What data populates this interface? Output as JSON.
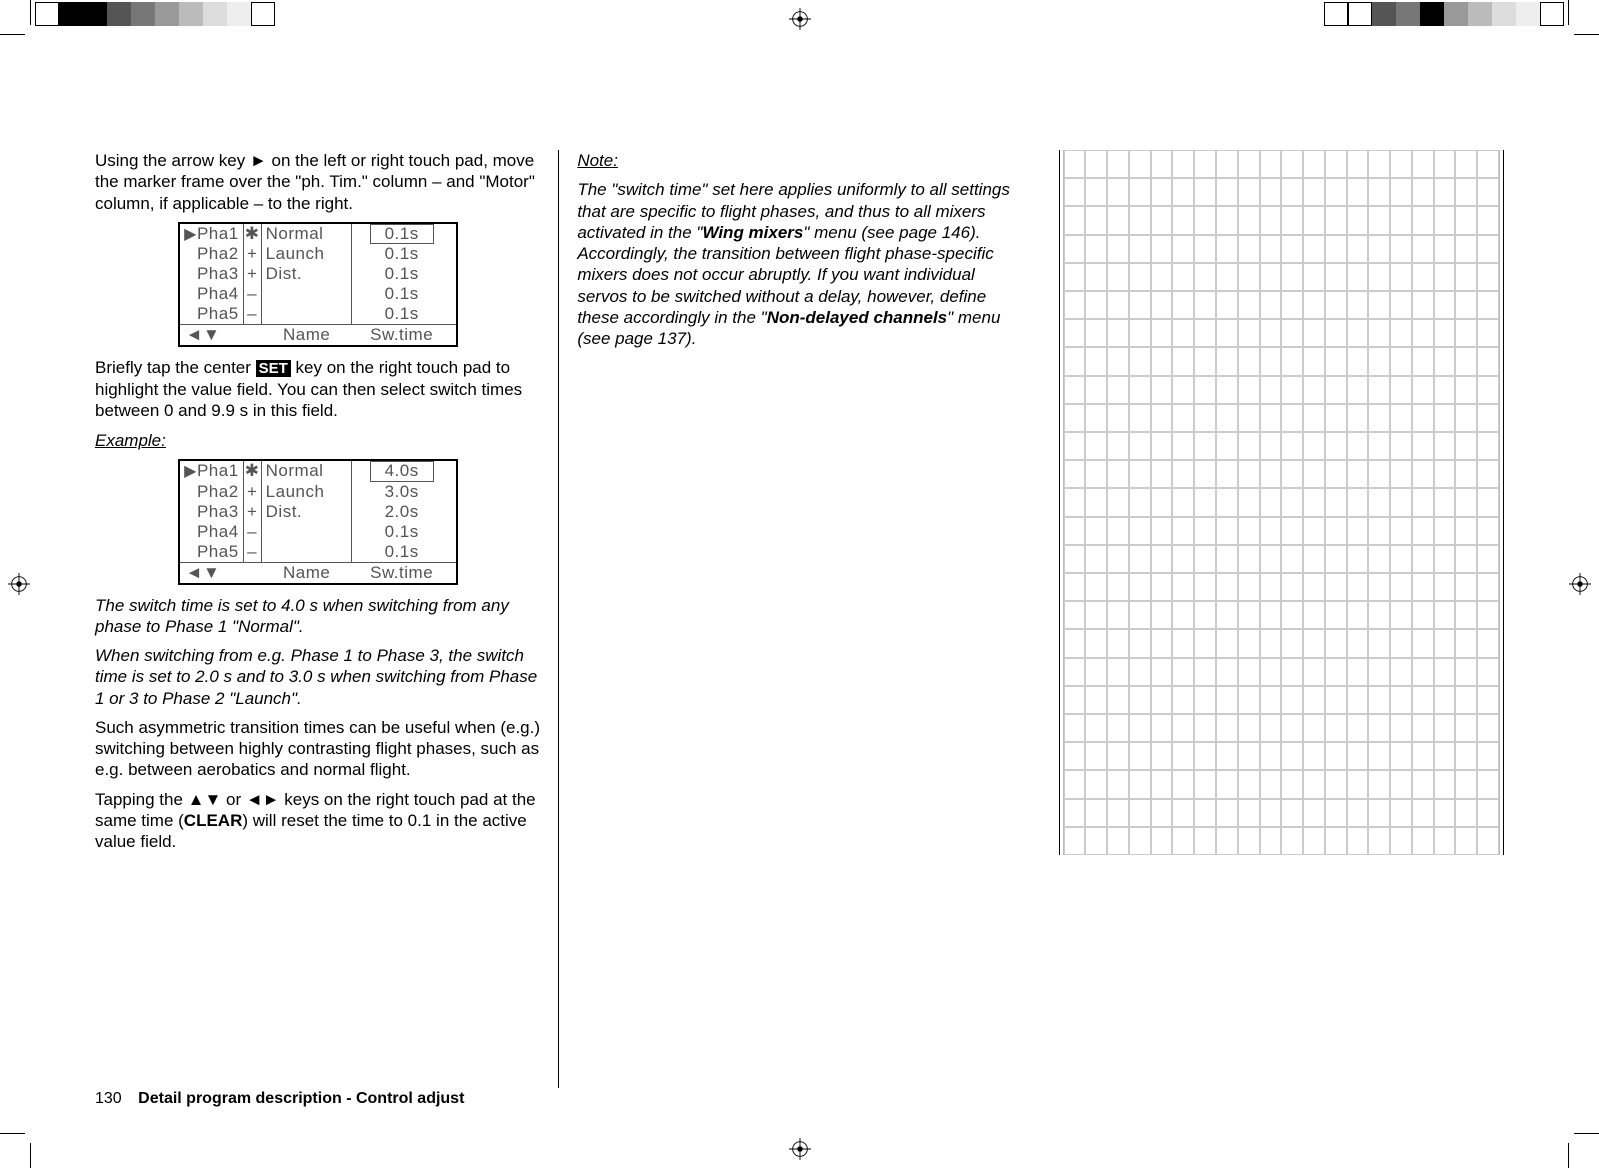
{
  "col1": {
    "para1_a": "Using the arrow key ",
    "para1_b": " on the left or right touch pad, move the marker frame over the \"ph. Tim.\" column – and \"Motor\" column, if applicable – to the right.",
    "lcd1": {
      "rows": [
        {
          "pha": "Pha1",
          "sym": "✱",
          "name": "Normal",
          "time": "0.1s",
          "hl": true,
          "tri": true
        },
        {
          "pha": "Pha2",
          "sym": "+",
          "name": "Launch",
          "time": "0.1s"
        },
        {
          "pha": "Pha3",
          "sym": "+",
          "name": "Dist.",
          "time": "0.1s"
        },
        {
          "pha": "Pha4",
          "sym": "–",
          "name": "",
          "time": "0.1s"
        },
        {
          "pha": "Pha5",
          "sym": "–",
          "name": "",
          "time": "0.1s"
        }
      ],
      "footer_arrows": "◄▼",
      "footer_name": "Name",
      "footer_sw": "Sw.time"
    },
    "para2_a": "Briefly tap the center ",
    "para2_set": "SET",
    "para2_b": " key on the right touch pad to highlight the value field. You can then select switch times between 0 and 9.9 s in this field.",
    "example_label": "Example:",
    "lcd2": {
      "rows": [
        {
          "pha": "Pha1",
          "sym": "✱",
          "name": "Normal",
          "time": "4.0s",
          "hl": true,
          "tri": true
        },
        {
          "pha": "Pha2",
          "sym": "+",
          "name": "Launch",
          "time": "3.0s"
        },
        {
          "pha": "Pha3",
          "sym": "+",
          "name": "Dist.",
          "time": "2.0s"
        },
        {
          "pha": "Pha4",
          "sym": "–",
          "name": "",
          "time": "0.1s"
        },
        {
          "pha": "Pha5",
          "sym": "–",
          "name": "",
          "time": "0.1s"
        }
      ],
      "footer_arrows": "◄▼",
      "footer_name": "Name",
      "footer_sw": "Sw.time"
    },
    "para3": "The switch time is set to 4.0 s when switching from any phase to Phase 1 \"Normal\".",
    "para4": "When switching from e.g. Phase 1 to Phase 3, the switch time is set to 2.0 s and to 3.0 s when switching from Phase 1 or 3 to Phase 2 \"Launch\".",
    "para5": "Such asymmetric transition times can be useful when (e.g.) switching between highly contrasting flight phases, such as e.g. between aerobatics and normal flight.",
    "para6_a": "Tapping the ",
    "para6_arrows1": "▲▼",
    "para6_b": " or ",
    "para6_arrows2": "◄►",
    "para6_c": " keys on the right touch pad at the same time (",
    "para6_clear": "CLEAR",
    "para6_d": ") will reset the time to 0.1 in the active value field."
  },
  "col2": {
    "note_label": "Note:",
    "note_a": "The \"switch time\" set here applies uniformly to all settings that are specific to flight phases, and thus to all mixers activated in the \"",
    "note_wing": "Wing mixers",
    "note_b": "\" menu (see page 146). Accordingly, the transition between flight phase-specific mixers does not occur abruptly. If you want individual servos to be switched without a delay, however, define these accordingly in the \"",
    "note_nd": "Non-delayed channels",
    "note_c": "\" menu (see page 137)."
  },
  "footer": {
    "page": "130",
    "section": "Detail program description - Control adjust"
  },
  "glyphs": {
    "right": "►"
  }
}
